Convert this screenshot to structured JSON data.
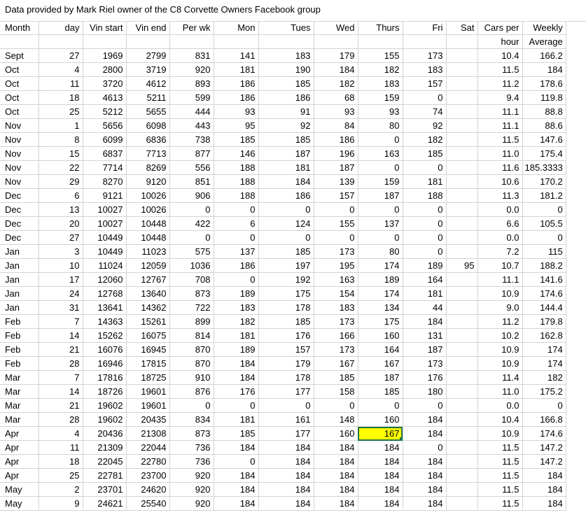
{
  "title": "Data provided by Mark Riel owner of the C8 Corvette Owners Facebook group",
  "headers": [
    "Month",
    "day",
    "Vin start",
    "Vin end",
    "Per wk",
    "Mon",
    "Tues",
    "Wed",
    "Thurs",
    "Fri",
    "Sat",
    "Cars per",
    "Weekly"
  ],
  "headers2": [
    "",
    "",
    "",
    "",
    "",
    "",
    "",
    "",
    "",
    "",
    "",
    "hour",
    "Average"
  ],
  "rows": [
    [
      "Sept",
      "27",
      "1969",
      "2799",
      "831",
      "141",
      "183",
      "179",
      "155",
      "173",
      "",
      "10.4",
      "166.2"
    ],
    [
      "Oct",
      "4",
      "2800",
      "3719",
      "920",
      "181",
      "190",
      "184",
      "182",
      "183",
      "",
      "11.5",
      "184"
    ],
    [
      "Oct",
      "11",
      "3720",
      "4612",
      "893",
      "186",
      "185",
      "182",
      "183",
      "157",
      "",
      "11.2",
      "178.6"
    ],
    [
      "Oct",
      "18",
      "4613",
      "5211",
      "599",
      "186",
      "186",
      "68",
      "159",
      "0",
      "",
      "9.4",
      "119.8"
    ],
    [
      "Oct",
      "25",
      "5212",
      "5655",
      "444",
      "93",
      "91",
      "93",
      "93",
      "74",
      "",
      "11.1",
      "88.8"
    ],
    [
      "Nov",
      "1",
      "5656",
      "6098",
      "443",
      "95",
      "92",
      "84",
      "80",
      "92",
      "",
      "11.1",
      "88.6"
    ],
    [
      "Nov",
      "8",
      "6099",
      "6836",
      "738",
      "185",
      "185",
      "186",
      "0",
      "182",
      "",
      "11.5",
      "147.6"
    ],
    [
      "Nov",
      "15",
      "6837",
      "7713",
      "877",
      "146",
      "187",
      "196",
      "163",
      "185",
      "",
      "11.0",
      "175.4"
    ],
    [
      "Nov",
      "22",
      "7714",
      "8269",
      "556",
      "188",
      "181",
      "187",
      "0",
      "0",
      "",
      "11.6",
      "185.3333"
    ],
    [
      "Nov",
      "29",
      "8270",
      "9120",
      "851",
      "188",
      "184",
      "139",
      "159",
      "181",
      "",
      "10.6",
      "170.2"
    ],
    [
      "Dec",
      "6",
      "9121",
      "10026",
      "906",
      "188",
      "186",
      "157",
      "187",
      "188",
      "",
      "11.3",
      "181.2"
    ],
    [
      "Dec",
      "13",
      "10027",
      "10026",
      "0",
      "0",
      "0",
      "0",
      "0",
      "0",
      "",
      "0.0",
      "0"
    ],
    [
      "Dec",
      "20",
      "10027",
      "10448",
      "422",
      "6",
      "124",
      "155",
      "137",
      "0",
      "",
      "6.6",
      "105.5"
    ],
    [
      "Dec",
      "27",
      "10449",
      "10448",
      "0",
      "0",
      "0",
      "0",
      "0",
      "0",
      "",
      "0.0",
      "0"
    ],
    [
      "Jan",
      "3",
      "10449",
      "11023",
      "575",
      "137",
      "185",
      "173",
      "80",
      "0",
      "",
      "7.2",
      "115"
    ],
    [
      "Jan",
      "10",
      "11024",
      "12059",
      "1036",
      "186",
      "197",
      "195",
      "174",
      "189",
      "95",
      "10.7",
      "188.2"
    ],
    [
      "Jan",
      "17",
      "12060",
      "12767",
      "708",
      "0",
      "192",
      "163",
      "189",
      "164",
      "",
      "11.1",
      "141.6"
    ],
    [
      "Jan",
      "24",
      "12768",
      "13640",
      "873",
      "189",
      "175",
      "154",
      "174",
      "181",
      "",
      "10.9",
      "174.6"
    ],
    [
      "Jan",
      "31",
      "13641",
      "14362",
      "722",
      "183",
      "178",
      "183",
      "134",
      "44",
      "",
      "9.0",
      "144.4"
    ],
    [
      "Feb",
      "7",
      "14363",
      "15261",
      "899",
      "182",
      "185",
      "173",
      "175",
      "184",
      "",
      "11.2",
      "179.8"
    ],
    [
      "Feb",
      "14",
      "15262",
      "16075",
      "814",
      "181",
      "176",
      "166",
      "160",
      "131",
      "",
      "10.2",
      "162.8"
    ],
    [
      "Feb",
      "21",
      "16076",
      "16945",
      "870",
      "189",
      "157",
      "173",
      "164",
      "187",
      "",
      "10.9",
      "174"
    ],
    [
      "Feb",
      "28",
      "16946",
      "17815",
      "870",
      "184",
      "179",
      "167",
      "167",
      "173",
      "",
      "10.9",
      "174"
    ],
    [
      "Mar",
      "7",
      "17816",
      "18725",
      "910",
      "184",
      "178",
      "185",
      "187",
      "176",
      "",
      "11.4",
      "182"
    ],
    [
      "Mar",
      "14",
      "18726",
      "19601",
      "876",
      "176",
      "177",
      "158",
      "185",
      "180",
      "",
      "11.0",
      "175.2"
    ],
    [
      "Mar",
      "21",
      "19602",
      "19601",
      "0",
      "0",
      "0",
      "0",
      "0",
      "0",
      "",
      "0.0",
      "0"
    ],
    [
      "Mar",
      "28",
      "19602",
      "20435",
      "834",
      "181",
      "161",
      "148",
      "160",
      "184",
      "",
      "10.4",
      "166.8"
    ],
    [
      "Apr",
      "4",
      "20436",
      "21308",
      "873",
      "185",
      "177",
      "160",
      "167",
      "184",
      "",
      "10.9",
      "174.6"
    ],
    [
      "Apr",
      "11",
      "21309",
      "22044",
      "736",
      "184",
      "184",
      "184",
      "184",
      "0",
      "",
      "11.5",
      "147.2"
    ],
    [
      "Apr",
      "18",
      "22045",
      "22780",
      "736",
      "0",
      "184",
      "184",
      "184",
      "184",
      "",
      "11.5",
      "147.2"
    ],
    [
      "Apr",
      "25",
      "22781",
      "23700",
      "920",
      "184",
      "184",
      "184",
      "184",
      "184",
      "",
      "11.5",
      "184"
    ],
    [
      "May",
      "2",
      "23701",
      "24620",
      "920",
      "184",
      "184",
      "184",
      "184",
      "184",
      "",
      "11.5",
      "184"
    ],
    [
      "May",
      "9",
      "24621",
      "25540",
      "920",
      "184",
      "184",
      "184",
      "184",
      "184",
      "",
      "11.5",
      "184"
    ]
  ],
  "selected_cell": {
    "row": 27,
    "col": 8
  },
  "colors": {
    "gridline": "#d4d4d4",
    "highlight": "#ffff00",
    "selection": "#217346"
  }
}
